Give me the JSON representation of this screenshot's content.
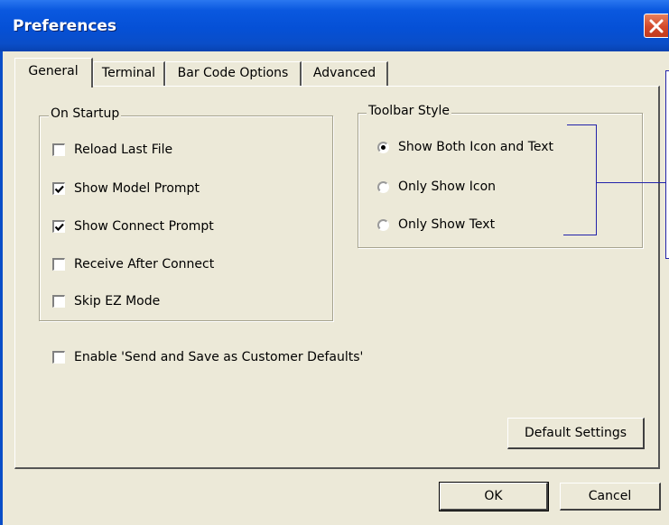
{
  "window": {
    "title": "Preferences"
  },
  "tabs": [
    {
      "label": "General",
      "active": true
    },
    {
      "label": "Terminal",
      "active": false
    },
    {
      "label": "Bar Code Options",
      "active": false
    },
    {
      "label": "Advanced",
      "active": false
    }
  ],
  "on_startup": {
    "legend": "On Startup",
    "options": [
      {
        "label": "Reload Last File",
        "checked": false
      },
      {
        "label": "Show Model Prompt",
        "checked": true
      },
      {
        "label": "Show Connect Prompt",
        "checked": true
      },
      {
        "label": "Receive After Connect",
        "checked": false
      },
      {
        "label": "Skip EZ Mode",
        "checked": false
      }
    ]
  },
  "toolbar_style": {
    "legend": "Toolbar Style",
    "options": [
      {
        "label": "Show Both Icon and Text",
        "selected": true
      },
      {
        "label": "Only Show Icon",
        "selected": false
      },
      {
        "label": "Only Show Text",
        "selected": false
      }
    ]
  },
  "enable_defaults": {
    "label": "Enable 'Send and Save as Customer Defaults'",
    "checked": false
  },
  "buttons": {
    "default_settings": "Default Settings",
    "ok": "OK",
    "cancel": "Cancel"
  },
  "colors": {
    "titlebar": "#0550d6",
    "dialog_bg": "#ece9d8",
    "close_button": "#d3492b",
    "annotation_line": "#2222aa"
  }
}
